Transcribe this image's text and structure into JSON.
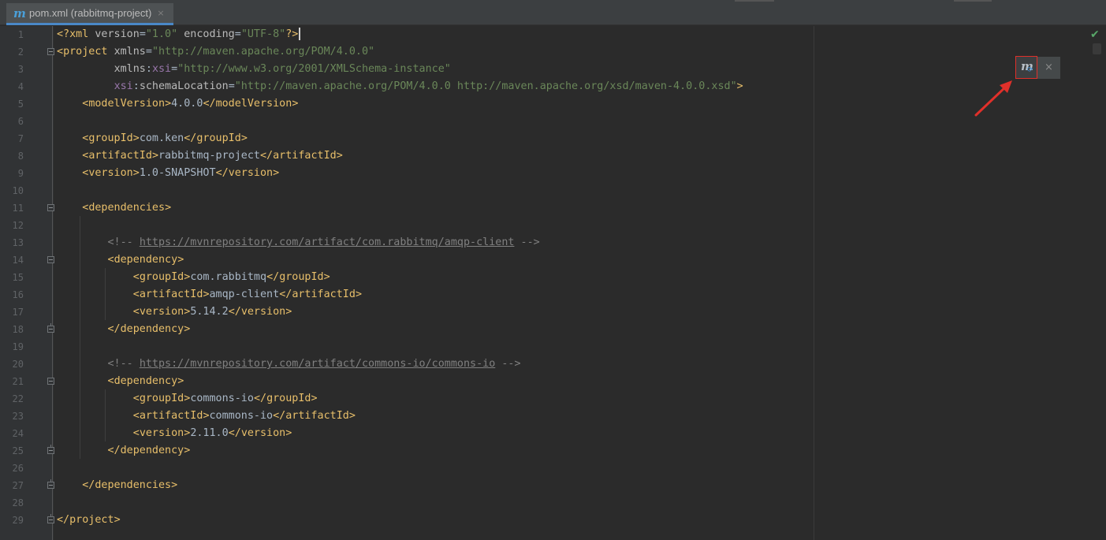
{
  "tab": {
    "icon": "maven-icon",
    "label": "pom.xml (rabbitmq-project)",
    "close": "×"
  },
  "maven_popup": {
    "icon": "maven-reload-icon",
    "icon_letter": "m",
    "sync_glyph": "⟳",
    "close": "×"
  },
  "status": {
    "inspection": "✔"
  },
  "line_numbers": [
    "1",
    "2",
    "3",
    "4",
    "5",
    "6",
    "7",
    "8",
    "9",
    "10",
    "11",
    "12",
    "13",
    "14",
    "15",
    "16",
    "17",
    "18",
    "19",
    "20",
    "21",
    "22",
    "23",
    "24",
    "25",
    "26",
    "27",
    "28",
    "29"
  ],
  "code_lines": [
    {
      "no": 1,
      "tokens": [
        [
          "br",
          "<?"
        ],
        [
          "tag",
          "xml "
        ],
        [
          "attr",
          "version"
        ],
        [
          "text",
          "="
        ],
        [
          "val",
          "\"1.0\""
        ],
        [
          "text",
          " "
        ],
        [
          "attr",
          "encoding"
        ],
        [
          "text",
          "="
        ],
        [
          "val",
          "\"UTF-8\""
        ],
        [
          "br",
          "?>"
        ]
      ],
      "caret": true
    },
    {
      "no": 2,
      "tokens": [
        [
          "br",
          "<"
        ],
        [
          "tag",
          "project "
        ],
        [
          "attr",
          "xmlns"
        ],
        [
          "text",
          "="
        ],
        [
          "val",
          "\"http://maven.apache.org/POM/4.0.0\""
        ]
      ]
    },
    {
      "no": 3,
      "tokens": [
        [
          "text",
          "         "
        ],
        [
          "attr",
          "xmlns"
        ],
        [
          "text",
          ":"
        ],
        [
          "ns",
          "xsi"
        ],
        [
          "text",
          "="
        ],
        [
          "val",
          "\"http://www.w3.org/2001/XMLSchema-instance\""
        ]
      ]
    },
    {
      "no": 4,
      "tokens": [
        [
          "text",
          "         "
        ],
        [
          "ns",
          "xsi"
        ],
        [
          "text",
          ":"
        ],
        [
          "attr",
          "schemaLocation"
        ],
        [
          "text",
          "="
        ],
        [
          "val",
          "\"http://maven.apache.org/POM/4.0.0 http://maven.apache.org/xsd/maven-4.0.0.xsd\""
        ],
        [
          "br",
          ">"
        ]
      ]
    },
    {
      "no": 5,
      "tokens": [
        [
          "text",
          "    "
        ],
        [
          "br",
          "<"
        ],
        [
          "tag",
          "modelVersion"
        ],
        [
          "br",
          ">"
        ],
        [
          "text",
          "4.0.0"
        ],
        [
          "br",
          "</"
        ],
        [
          "tag",
          "modelVersion"
        ],
        [
          "br",
          ">"
        ]
      ]
    },
    {
      "no": 6,
      "tokens": []
    },
    {
      "no": 7,
      "tokens": [
        [
          "text",
          "    "
        ],
        [
          "br",
          "<"
        ],
        [
          "tag",
          "groupId"
        ],
        [
          "br",
          ">"
        ],
        [
          "text",
          "com.ken"
        ],
        [
          "br",
          "</"
        ],
        [
          "tag",
          "groupId"
        ],
        [
          "br",
          ">"
        ]
      ]
    },
    {
      "no": 8,
      "tokens": [
        [
          "text",
          "    "
        ],
        [
          "br",
          "<"
        ],
        [
          "tag",
          "artifactId"
        ],
        [
          "br",
          ">"
        ],
        [
          "text",
          "rabbitmq-project"
        ],
        [
          "br",
          "</"
        ],
        [
          "tag",
          "artifactId"
        ],
        [
          "br",
          ">"
        ]
      ]
    },
    {
      "no": 9,
      "tokens": [
        [
          "text",
          "    "
        ],
        [
          "br",
          "<"
        ],
        [
          "tag",
          "version"
        ],
        [
          "br",
          ">"
        ],
        [
          "text",
          "1.0-SNAPSHOT"
        ],
        [
          "br",
          "</"
        ],
        [
          "tag",
          "version"
        ],
        [
          "br",
          ">"
        ]
      ]
    },
    {
      "no": 10,
      "tokens": []
    },
    {
      "no": 11,
      "tokens": [
        [
          "text",
          "    "
        ],
        [
          "br",
          "<"
        ],
        [
          "tag",
          "dependencies"
        ],
        [
          "br",
          ">"
        ]
      ]
    },
    {
      "no": 12,
      "tokens": []
    },
    {
      "no": 13,
      "tokens": [
        [
          "text",
          "        "
        ],
        [
          "com",
          "<!-- "
        ],
        [
          "link",
          "https://mvnrepository.com/artifact/com.rabbitmq/amqp-client"
        ],
        [
          "com",
          " -->"
        ]
      ]
    },
    {
      "no": 14,
      "tokens": [
        [
          "text",
          "        "
        ],
        [
          "br",
          "<"
        ],
        [
          "tag",
          "dependency"
        ],
        [
          "br",
          ">"
        ]
      ]
    },
    {
      "no": 15,
      "tokens": [
        [
          "text",
          "            "
        ],
        [
          "br",
          "<"
        ],
        [
          "tag",
          "groupId"
        ],
        [
          "br",
          ">"
        ],
        [
          "text",
          "com.rabbitmq"
        ],
        [
          "br",
          "</"
        ],
        [
          "tag",
          "groupId"
        ],
        [
          "br",
          ">"
        ]
      ]
    },
    {
      "no": 16,
      "tokens": [
        [
          "text",
          "            "
        ],
        [
          "br",
          "<"
        ],
        [
          "tag",
          "artifactId"
        ],
        [
          "br",
          ">"
        ],
        [
          "text",
          "amqp-client"
        ],
        [
          "br",
          "</"
        ],
        [
          "tag",
          "artifactId"
        ],
        [
          "br",
          ">"
        ]
      ]
    },
    {
      "no": 17,
      "tokens": [
        [
          "text",
          "            "
        ],
        [
          "br",
          "<"
        ],
        [
          "tag",
          "version"
        ],
        [
          "br",
          ">"
        ],
        [
          "text",
          "5.14.2"
        ],
        [
          "br",
          "</"
        ],
        [
          "tag",
          "version"
        ],
        [
          "br",
          ">"
        ]
      ]
    },
    {
      "no": 18,
      "tokens": [
        [
          "text",
          "        "
        ],
        [
          "br",
          "</"
        ],
        [
          "tag",
          "dependency"
        ],
        [
          "br",
          ">"
        ]
      ]
    },
    {
      "no": 19,
      "tokens": []
    },
    {
      "no": 20,
      "tokens": [
        [
          "text",
          "        "
        ],
        [
          "com",
          "<!-- "
        ],
        [
          "link",
          "https://mvnrepository.com/artifact/commons-io/commons-io"
        ],
        [
          "com",
          " -->"
        ]
      ]
    },
    {
      "no": 21,
      "tokens": [
        [
          "text",
          "        "
        ],
        [
          "br",
          "<"
        ],
        [
          "tag",
          "dependency"
        ],
        [
          "br",
          ">"
        ]
      ]
    },
    {
      "no": 22,
      "tokens": [
        [
          "text",
          "            "
        ],
        [
          "br",
          "<"
        ],
        [
          "tag",
          "groupId"
        ],
        [
          "br",
          ">"
        ],
        [
          "text",
          "commons-io"
        ],
        [
          "br",
          "</"
        ],
        [
          "tag",
          "groupId"
        ],
        [
          "br",
          ">"
        ]
      ]
    },
    {
      "no": 23,
      "tokens": [
        [
          "text",
          "            "
        ],
        [
          "br",
          "<"
        ],
        [
          "tag",
          "artifactId"
        ],
        [
          "br",
          ">"
        ],
        [
          "text",
          "commons-io"
        ],
        [
          "br",
          "</"
        ],
        [
          "tag",
          "artifactId"
        ],
        [
          "br",
          ">"
        ]
      ]
    },
    {
      "no": 24,
      "tokens": [
        [
          "text",
          "            "
        ],
        [
          "br",
          "<"
        ],
        [
          "tag",
          "version"
        ],
        [
          "br",
          ">"
        ],
        [
          "text",
          "2.11.0"
        ],
        [
          "br",
          "</"
        ],
        [
          "tag",
          "version"
        ],
        [
          "br",
          ">"
        ]
      ]
    },
    {
      "no": 25,
      "tokens": [
        [
          "text",
          "        "
        ],
        [
          "br",
          "</"
        ],
        [
          "tag",
          "dependency"
        ],
        [
          "br",
          ">"
        ]
      ]
    },
    {
      "no": 26,
      "tokens": []
    },
    {
      "no": 27,
      "tokens": [
        [
          "text",
          "    "
        ],
        [
          "br",
          "</"
        ],
        [
          "tag",
          "dependencies"
        ],
        [
          "br",
          ">"
        ]
      ]
    },
    {
      "no": 28,
      "tokens": []
    },
    {
      "no": 29,
      "tokens": [
        [
          "br",
          "</"
        ],
        [
          "tag",
          "project"
        ],
        [
          "br",
          ">"
        ]
      ]
    }
  ],
  "colors": {
    "editor_bg": "#2b2b2b",
    "tag": "#e8bf6a",
    "attribute": "#bababa",
    "namespace": "#9876aa",
    "string": "#6a8759",
    "comment": "#808080",
    "highlight_box": "#e0302a",
    "arrow": "#e0302a"
  }
}
